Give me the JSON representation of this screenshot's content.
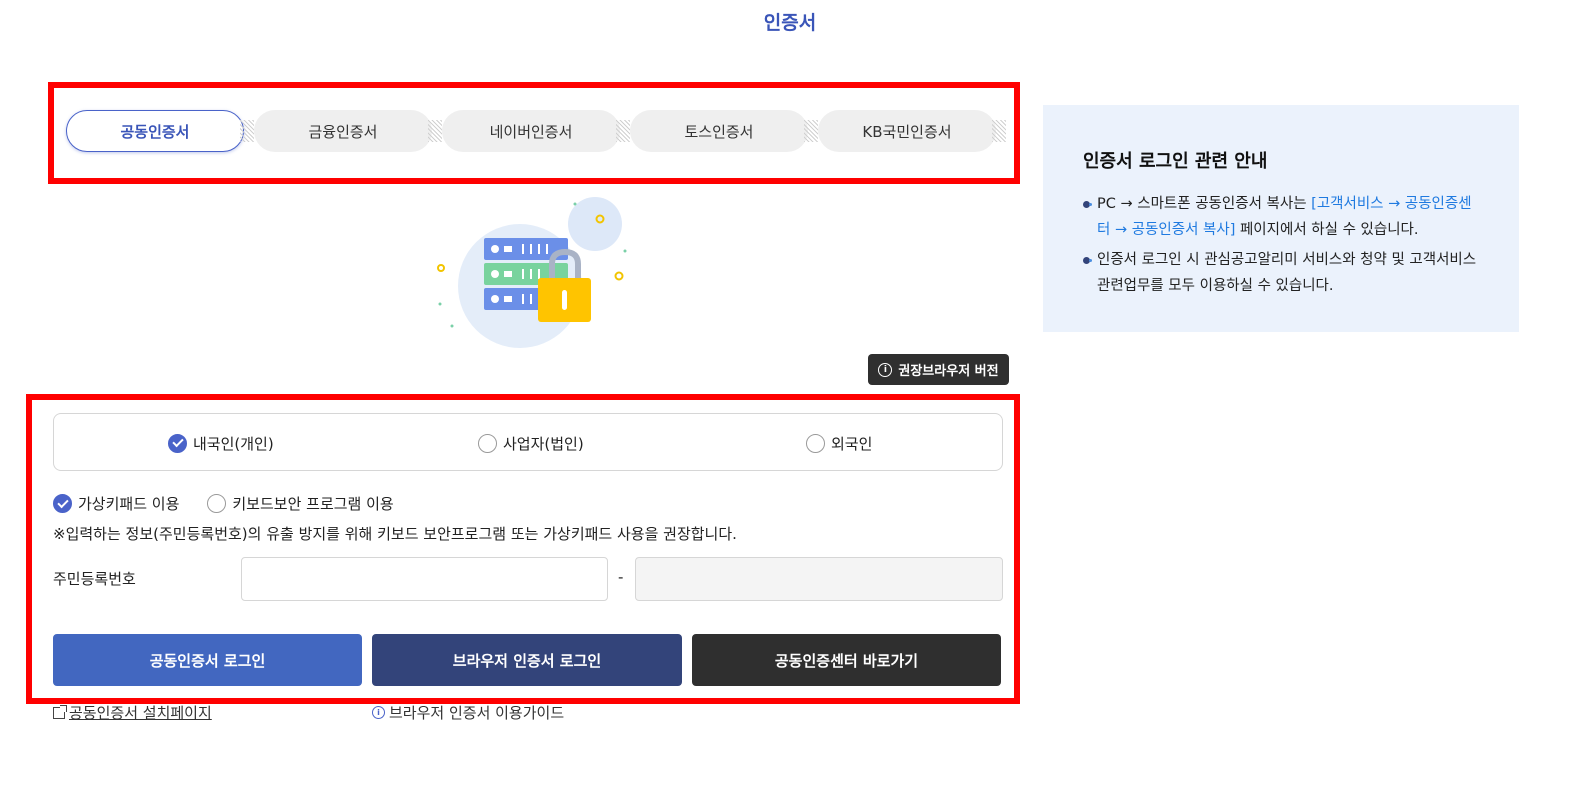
{
  "page": {
    "title": "인증서"
  },
  "tabs": [
    {
      "label": "공동인증서",
      "active": true
    },
    {
      "label": "금융인증서",
      "active": false
    },
    {
      "label": "네이버인증서",
      "active": false
    },
    {
      "label": "토스인증서",
      "active": false
    },
    {
      "label": "KB국민인증서",
      "active": false
    }
  ],
  "illustration": {
    "icon": "server-lock-icon"
  },
  "browser_button": {
    "label": "권장브라우저 버전"
  },
  "user_type": {
    "options": [
      {
        "label": "내국인(개인)",
        "checked": true
      },
      {
        "label": "사업자(법인)",
        "checked": false
      },
      {
        "label": "외국인",
        "checked": false
      }
    ]
  },
  "keypad": {
    "options": [
      {
        "label": "가상키패드 이용",
        "checked": true
      },
      {
        "label": "키보드보안 프로그램 이용",
        "checked": false
      }
    ],
    "notice": "※입력하는 정보(주민등록번호)의 유출 방지를 위해 키보드 보안프로그램 또는 가상키패드 사용을 권장합니다."
  },
  "rrn": {
    "label": "주민등록번호",
    "separator": "-",
    "first_value": "",
    "second_value": ""
  },
  "actions": {
    "joint_cert_login": "공동인증서 로그인",
    "browser_cert_login": "브라우저 인증서 로그인",
    "joint_cert_center": "공동인증센터 바로가기"
  },
  "links": {
    "install_page": "공동인증서 설치페이지",
    "browser_guide": "브라우저 인증서 이용가이드"
  },
  "guide": {
    "title": "인증서 로그인 관련 안내",
    "item1_prefix": "PC → 스마트폰 공동인증서 복사는 ",
    "item1_link": "[고객서비스 → 공동인증센터 → 공동인증서 복사]",
    "item1_suffix": " 페이지에서 하실 수 있습니다.",
    "item2": "인증서 로그인 시 관심공고알리미 서비스와 청약 및 고객서비스 관련업무를 모두 이용하실 수 있습니다."
  },
  "colors": {
    "accent": "#4a63c9",
    "primary_button": "#4267c0",
    "secondary_button": "#33447a",
    "dark_button": "#2f2f2f",
    "highlight_border": "#ff0000",
    "panel_bg": "#ebf2fc"
  }
}
